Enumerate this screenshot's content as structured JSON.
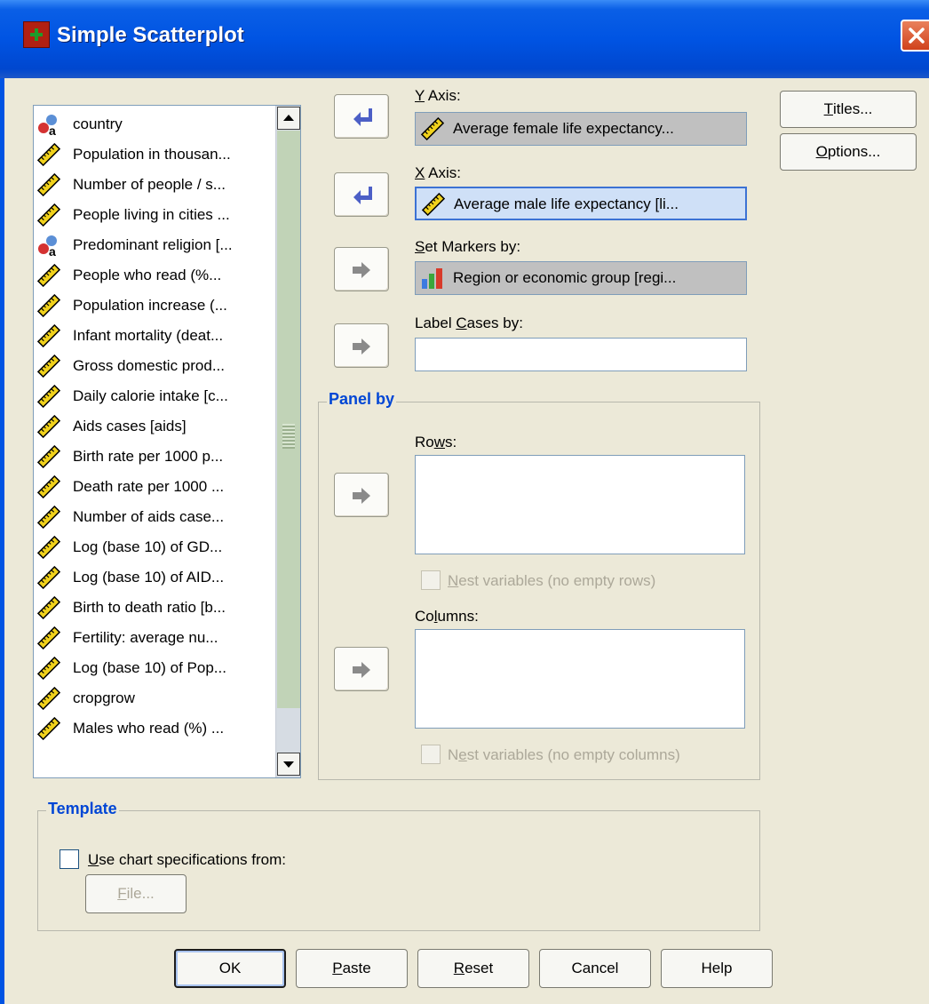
{
  "window": {
    "title": "Simple Scatterplot",
    "icon": "spss-chart-icon",
    "close_icon": "close-icon"
  },
  "variables": [
    {
      "label": "country",
      "icon": "nominal-string-icon"
    },
    {
      "label": "Population in thousan...",
      "icon": "scale-ruler-icon"
    },
    {
      "label": "Number of people / s...",
      "icon": "scale-ruler-icon"
    },
    {
      "label": "People living in cities ...",
      "icon": "scale-ruler-icon"
    },
    {
      "label": "Predominant religion [...",
      "icon": "nominal-string-icon"
    },
    {
      "label": "People who read (%...",
      "icon": "scale-ruler-icon"
    },
    {
      "label": "Population increase (...",
      "icon": "scale-ruler-icon"
    },
    {
      "label": "Infant mortality (deat...",
      "icon": "scale-ruler-icon"
    },
    {
      "label": "Gross domestic prod...",
      "icon": "scale-ruler-icon"
    },
    {
      "label": "Daily calorie intake [c...",
      "icon": "scale-ruler-icon"
    },
    {
      "label": "Aids cases [aids]",
      "icon": "scale-ruler-icon"
    },
    {
      "label": "Birth rate per 1000 p...",
      "icon": "scale-ruler-icon"
    },
    {
      "label": "Death rate per 1000 ...",
      "icon": "scale-ruler-icon"
    },
    {
      "label": "Number of aids case...",
      "icon": "scale-ruler-icon"
    },
    {
      "label": "Log (base 10) of GD...",
      "icon": "scale-ruler-icon"
    },
    {
      "label": "Log (base 10) of AID...",
      "icon": "scale-ruler-icon"
    },
    {
      "label": "Birth to death ratio [b...",
      "icon": "scale-ruler-icon"
    },
    {
      "label": "Fertility: average nu...",
      "icon": "scale-ruler-icon"
    },
    {
      "label": "Log (base 10) of Pop...",
      "icon": "scale-ruler-icon"
    },
    {
      "label": "cropgrow",
      "icon": "scale-ruler-icon"
    },
    {
      "label": "Males who read (%) ...",
      "icon": "scale-ruler-icon"
    }
  ],
  "fields": {
    "y_axis": {
      "label": "Y Axis:",
      "value": "Average female life expectancy...",
      "icon": "scale-ruler-icon"
    },
    "x_axis": {
      "label": "X Axis:",
      "value": "Average male life expectancy [li...",
      "icon": "scale-ruler-icon"
    },
    "set_markers": {
      "label": "Set Markers by:",
      "value": "Region or economic group [regi...",
      "icon": "nominal-bars-icon"
    },
    "label_cases": {
      "label": "Label Cases by:",
      "value": ""
    }
  },
  "panel_by": {
    "title": "Panel by",
    "rows_label": "Rows:",
    "rows_nest": "Nest variables (no empty rows)",
    "columns_label": "Columns:",
    "columns_nest": "Nest variables (no empty columns)"
  },
  "template": {
    "title": "Template",
    "use_spec": "Use chart specifications from:",
    "file_button": "File..."
  },
  "side_buttons": {
    "titles": "Titles...",
    "options": "Options..."
  },
  "footer": {
    "ok": "OK",
    "paste": "Paste",
    "reset": "Reset",
    "cancel": "Cancel",
    "help": "Help"
  },
  "colors": {
    "titlebar": "#0054e3",
    "dialog_bg": "#ece9d8",
    "group_title": "#0046d5",
    "active_arrow": "#4c5fc6",
    "inactive_arrow": "#8a8a8a"
  }
}
